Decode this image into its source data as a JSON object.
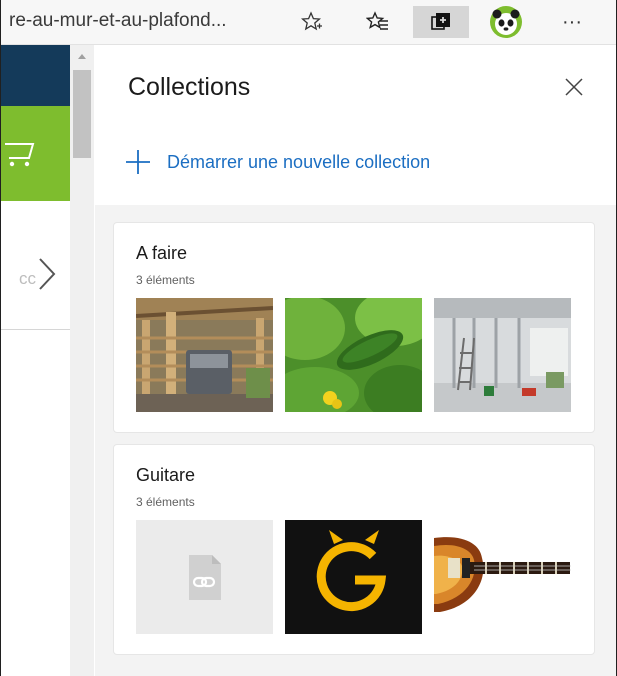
{
  "browser": {
    "url_fragment": "re-au-mur-et-au-plafond...",
    "icons": [
      "add-favorite-icon",
      "favorites-icon",
      "collections-icon",
      "profile-avatar-icon",
      "more-icon"
    ],
    "more_label": "···"
  },
  "page": {
    "faded_text": "cc"
  },
  "collections_panel": {
    "title": "Collections",
    "new_collection_label": "Démarrer une nouvelle collection",
    "collections": [
      {
        "name": "A faire",
        "count_label": "3 éléments",
        "thumbnails": [
          "bbq-pergola-photo",
          "cucumber-plant-photo",
          "room-renovation-photo"
        ]
      },
      {
        "name": "Guitare",
        "count_label": "3 éléments",
        "thumbnails": [
          "link-placeholder-icon",
          "g-logo",
          "electric-guitar-photo"
        ]
      }
    ]
  },
  "colors": {
    "accent": "#1b6ec2",
    "navy": "#143a5a",
    "green": "#7ebd2e",
    "g_logo_yellow": "#f5b400"
  }
}
